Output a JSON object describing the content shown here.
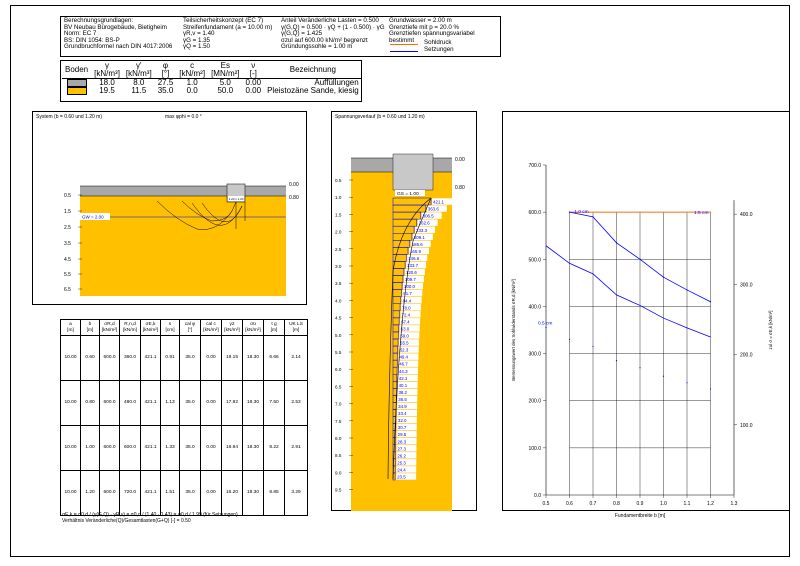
{
  "header": {
    "col1": [
      "Berechnungsgrundlagen:",
      "BV Neubau Bürogebäude, Bietigheim",
      "Norm: EC 7",
      "BS: DIN 1054: BS-P",
      "Grundbruchformel nach DIN 4017:2006"
    ],
    "col2": [
      "Teilsicherheitskonzept (EC 7)",
      "Streifenfundament (a = 10.00 m)",
      "γR,v = 1.40",
      "γG = 1.35",
      "γQ = 1.50"
    ],
    "col3": [
      "Anteil Veränderliche Lasten = 0.500",
      "γ(G,Q) = 0.500 · γQ + (1 - 0.500) · γG",
      "γ(G,Q) = 1.425",
      "σzul auf 600.00 kN/m² begrenzt",
      "Gründungssohle = 1.00 m"
    ],
    "col4": [
      "Grundwasser = 2.00 m",
      "Grenztiefe mit p = 20.0 %",
      "Grenztiefen spannungsvariabel bestimmt"
    ],
    "legend": [
      {
        "label": "Sohldruck",
        "color": "#ff6a00"
      },
      {
        "label": "Setzungen",
        "color": "#0000ff"
      }
    ]
  },
  "soil_table": {
    "headers": [
      "Boden",
      "γ",
      "γ'",
      "φ",
      "c",
      "Es",
      "ν",
      "Bezeichnung"
    ],
    "units": [
      "",
      "[kN/m³]",
      "[kN/m³]",
      "[°]",
      "[kN/m²]",
      "[MN/m²]",
      "[-]",
      ""
    ],
    "rows": [
      {
        "color": "#a8a8a8",
        "values": [
          "18.0",
          "8.0",
          "27.5",
          "1.0",
          "5.0",
          "0.00",
          "Auffüllungen"
        ]
      },
      {
        "color": "#ffc000",
        "values": [
          "19.5",
          "11.5",
          "35.0",
          "0.0",
          "50.0",
          "0.00",
          "Pleistozäne Sande, kiesig"
        ]
      }
    ]
  },
  "system_panel": {
    "title": "System (b = 0.60 und 1.20 m)",
    "subtitle": "max φphi = 0.0 °",
    "level_labels": [
      "0.00",
      "0.80"
    ],
    "depth_ticks": [
      "0.5",
      "1.5",
      "2.5",
      "3.5",
      "4.5",
      "5.5",
      "6.5"
    ],
    "gw_label": "GW = 2.00",
    "footing_label": "1.20 x 1.20"
  },
  "results_table": {
    "headers": [
      "a\n[m]",
      "b\n[m]",
      "σR,d\n[kN/m²]",
      "R,n,d\n[kN/m]",
      "σE,k\n[kN/m²]",
      "s\n[cm]",
      "cal φ\n[°]",
      "cal c\n[kN/m²]",
      "γ2\n[kN/m³]",
      "σü\n[kN/m²]",
      "t g\n[m]",
      "UK LS\n[m]"
    ],
    "rows": [
      [
        "10.00",
        "0.60",
        "600.0",
        "360.0",
        "421.1",
        "0.91",
        "35.0",
        "0.00",
        "19.15",
        "18.30",
        "6.66",
        "2.14"
      ],
      [
        "10.00",
        "0.80",
        "600.0",
        "480.0",
        "421.1",
        "1.13",
        "35.0",
        "0.00",
        "17.92",
        "18.30",
        "7.50",
        "2.53"
      ],
      [
        "10.00",
        "1.00",
        "600.0",
        "600.0",
        "421.1",
        "1.33",
        "35.0",
        "0.00",
        "16.94",
        "18.30",
        "8.22",
        "2.91"
      ],
      [
        "10.00",
        "1.20",
        "600.0",
        "720.0",
        "421.1",
        "1.51",
        "35.0",
        "0.00",
        "16.20",
        "18.30",
        "8.85",
        "3.29"
      ]
    ],
    "footnote1": "σE,k = σ0,d / (γ(G,Q) · γR,v) = σ0,d / (1.40 · 1.43) = σ0,d / 1.99  (für Setzungen)",
    "footnote2": "Verhältnis Veränderliche(Q)/Gesamtlasten(G+Q) [-] = 0.50"
  },
  "stress_panel": {
    "title": "Spannungsverlauf (b = 0.60 und 1.20 m)",
    "level_labels": [
      "0.00",
      "0.80"
    ],
    "depth_ticks": [
      "0.5",
      "1.0",
      "1.5",
      "2.0",
      "2.5",
      "3.0",
      "3.5",
      "4.0",
      "4.5",
      "5.0",
      "5.5",
      "6.0",
      "6.5",
      "7.0",
      "7.5",
      "8.0",
      "8.5",
      "9.0",
      "9.5"
    ],
    "gs_label": "GS = 1.00",
    "values": [
      "421.1",
      "363.6",
      "306.5",
      "262.6",
      "233.3",
      "209.1",
      "185.6",
      "165.9",
      "146.6",
      "133.7",
      "120.6",
      "109.7",
      "100.0",
      "91.7",
      "84.4",
      "78.0",
      "72.4",
      "67.4",
      "63.0",
      "59.0",
      "55.5",
      "52.3",
      "49.4",
      "46.7",
      "44.3",
      "42.1",
      "40.1",
      "38.2",
      "36.5",
      "34.9",
      "33.4",
      "32.0",
      "30.7",
      "29.5",
      "28.3",
      "27.3",
      "26.2",
      "25.3",
      "24.4",
      "23.5"
    ]
  },
  "chart_data": {
    "type": "line",
    "xlabel": "Fundamentbreite b [m]",
    "ylabel_left": "Bemessungswert des Sohlwiderstands σR,d [kN/m²]",
    "ylabel_right": "zul σ = σE,k [kN/m²]",
    "xlim": [
      0.5,
      1.3
    ],
    "ylim_left": [
      0,
      700
    ],
    "ylim_right": [
      0,
      470
    ],
    "x_ticks": [
      "0.5",
      "0.6",
      "0.7",
      "0.8",
      "0.9",
      "1.0",
      "1.1",
      "1.2",
      "1.3"
    ],
    "y_ticks_left": [
      "0.0",
      "100.0",
      "200.0",
      "300.0",
      "400.0",
      "500.0",
      "600.0",
      "700.0"
    ],
    "y_ticks_right": [
      "100.0",
      "200.0",
      "300.0",
      "400.0"
    ],
    "annotations": [
      "1.0 cm",
      "1.5 cm",
      "0.5 cm"
    ],
    "series": [
      {
        "color": "#ff6a00",
        "x": [
          0.6,
          1.2
        ],
        "y": [
          600,
          600
        ]
      },
      {
        "color": "#0000ff",
        "x": [
          0.6,
          0.7,
          0.8,
          0.9,
          1.0,
          1.1,
          1.2
        ],
        "y": [
          600,
          590,
          535,
          500,
          462,
          435,
          410
        ]
      },
      {
        "color": "#0000ff",
        "x": [
          0.5,
          0.6,
          0.7,
          0.8,
          0.9,
          1.0,
          1.1,
          1.2
        ],
        "y": [
          355,
          330,
          315,
          285,
          270,
          252,
          238,
          225
        ]
      }
    ]
  }
}
